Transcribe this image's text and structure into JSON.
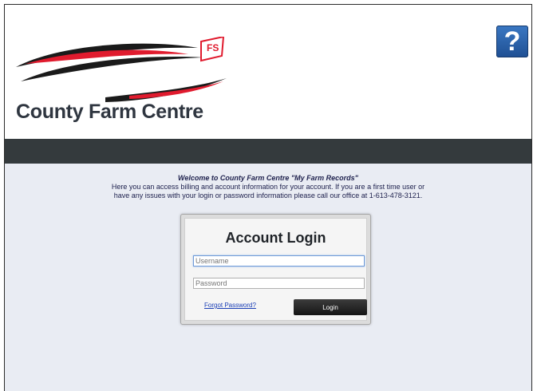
{
  "header": {
    "brand_name": "County Farm Centre",
    "logo_badge": "FS",
    "help_label": "?",
    "help_icon": "help-icon"
  },
  "colors": {
    "navbar": "#343a3d",
    "page_bg": "#e9ecf3",
    "help_blue": "#2b63ad",
    "logo_red": "#e01b2e"
  },
  "welcome": {
    "title": "Welcome to County Farm Centre \"My Farm Records\"",
    "line1": "Here you can access billing and account information for your account. If you are a first time user or",
    "line2": "have any issues with your login or password information please call our office at 1-613-478-3121."
  },
  "login": {
    "title": "Account Login",
    "username_placeholder": "Username",
    "password_placeholder": "Password",
    "forgot_label": "Forgot Password?",
    "login_label": "Login"
  }
}
